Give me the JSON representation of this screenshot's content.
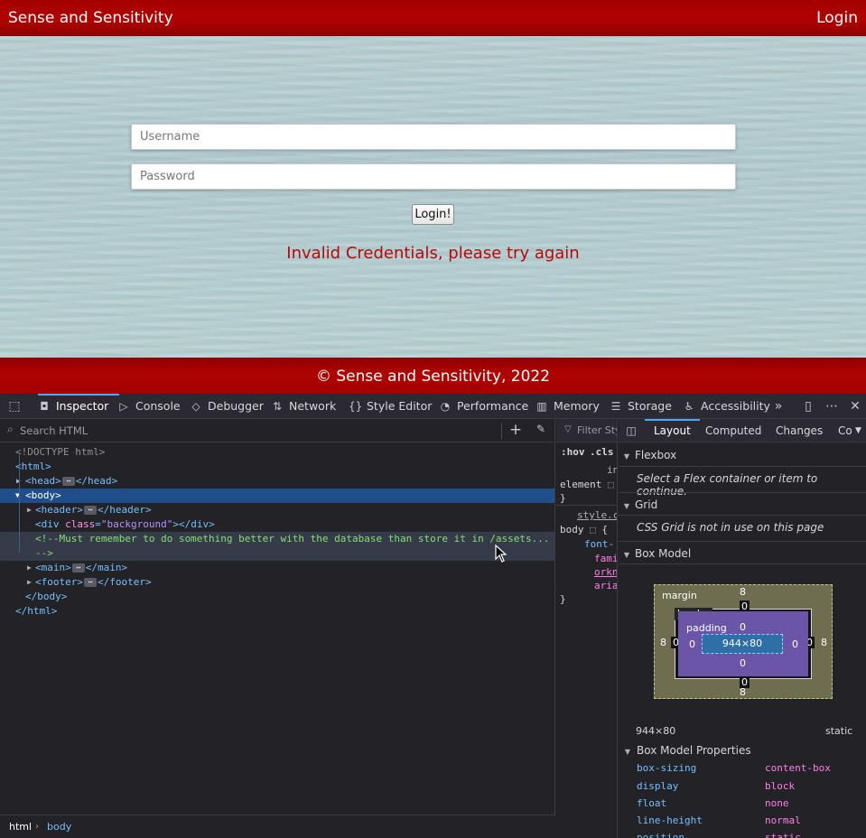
{
  "site": {
    "title": "Sense and Sensitivity",
    "login_link": "Login",
    "username_placeholder": "Username",
    "password_placeholder": "Password",
    "login_button": "Login!",
    "error_message": "Invalid Credentials, please try again",
    "footer": "© Sense and Sensitivity, 2022"
  },
  "devtools": {
    "tabs": [
      "Inspector",
      "Console",
      "Debugger",
      "Network",
      "Style Editor",
      "Performance",
      "Memory",
      "Storage",
      "Accessibility"
    ],
    "search_placeholder": "Search HTML",
    "markup": {
      "doctype": "<!DOCTYPE html>",
      "html_open": "html",
      "head": "head",
      "body": "body",
      "header": "header",
      "div_tag": "div",
      "div_attr": "class",
      "div_val": "\"background\"",
      "comment_line1": "<!--Must remember to do something better with the database than store it in /assets...",
      "comment_line2": "-->",
      "main": "main",
      "footer": "footer"
    },
    "breadcrumbs": [
      "html",
      "body"
    ],
    "rules": {
      "filter": "Filter Styl",
      "hov": ":hov",
      "cls": ".cls",
      "inline_frag": "in",
      "element_frag": "element",
      "close_brace": "}",
      "source": "style.c",
      "body_selector": "body",
      "open_brace": "{",
      "prop_frag": "font-",
      "val_frags": [
        "fami",
        "orkn",
        "aria"
      ]
    },
    "layout": {
      "tabs": [
        "Layout",
        "Computed",
        "Changes",
        "Co"
      ],
      "flexbox_title": "Flexbox",
      "flexbox_note": "Select a Flex container or item to continue.",
      "grid_title": "Grid",
      "grid_note": "CSS Grid is not in use on this page",
      "boxmodel_title": "Box Model",
      "box": {
        "margin_label": "margin",
        "border_label": "border",
        "padding_label": "padding",
        "margin_top": "8",
        "margin_right": "8",
        "margin_bottom": "8",
        "margin_left": "8",
        "border_top": "0",
        "border_right": "0",
        "border_bottom": "0",
        "border_left": "0",
        "padding_top": "0",
        "padding_right": "0",
        "padding_bottom": "0",
        "padding_left": "0",
        "content": "944×80"
      },
      "dimensions": "944×80",
      "position": "static",
      "props_title": "Box Model Properties",
      "properties": [
        {
          "name": "box-sizing",
          "value": "content-box"
        },
        {
          "name": "display",
          "value": "block"
        },
        {
          "name": "float",
          "value": "none"
        },
        {
          "name": "line-height",
          "value": "normal"
        },
        {
          "name": "position",
          "value": "static"
        }
      ]
    }
  }
}
